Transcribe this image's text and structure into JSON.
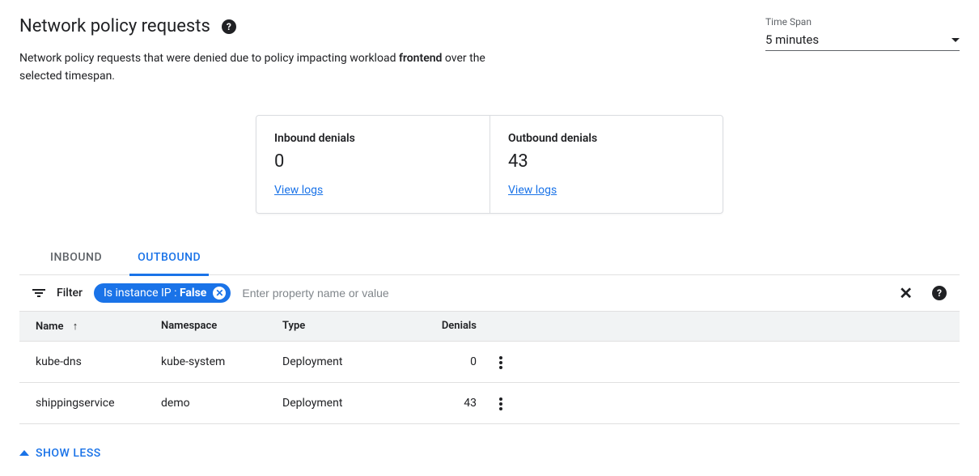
{
  "header": {
    "title": "Network policy requests",
    "description_prefix": "Network policy requests that were denied due to policy impacting workload ",
    "description_bold": "frontend",
    "description_suffix": " over the selected timespan."
  },
  "timespan": {
    "label": "Time Span",
    "value": "5 minutes"
  },
  "cards": {
    "inbound": {
      "title": "Inbound denials",
      "value": "0",
      "link": "View logs"
    },
    "outbound": {
      "title": "Outbound denials",
      "value": "43",
      "link": "View logs"
    }
  },
  "tabs": {
    "inbound": "INBOUND",
    "outbound": "OUTBOUND"
  },
  "filter": {
    "label": "Filter",
    "chip_key": "Is instance IP : ",
    "chip_value": "False",
    "placeholder": "Enter property name or value"
  },
  "table": {
    "headers": {
      "name": "Name",
      "namespace": "Namespace",
      "type": "Type",
      "denials": "Denials"
    },
    "rows": [
      {
        "name": "kube-dns",
        "namespace": "kube-system",
        "type": "Deployment",
        "denials": "0"
      },
      {
        "name": "shippingservice",
        "namespace": "demo",
        "type": "Deployment",
        "denials": "43"
      }
    ]
  },
  "footer": {
    "show_less": "SHOW LESS"
  }
}
